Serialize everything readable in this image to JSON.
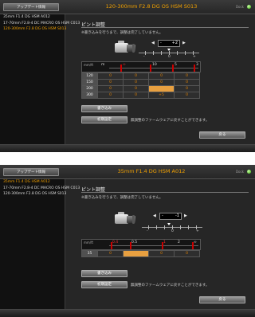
{
  "screens": [
    {
      "update_button": "アップデート情報",
      "title": "120-300mm F2.8 DG OS HSM S013",
      "dock_label": "Dock",
      "lenses": [
        "35mm F1.4 DG HSM A012",
        "17-70mm F2.8-4 DC MACRO OS HSM C013",
        "120-300mm F2.8 DG OS HSM S013"
      ],
      "active_lens": 2,
      "section_title": "ピント調整",
      "note": "※書き込みを行うまで、調整は完了していません。",
      "stepper_value": "+2",
      "scale": {
        "left": "-",
        "mid": "0",
        "right": "+"
      },
      "focus_header": {
        "corner": "mm/ft",
        "labels": [
          "m",
          "∞",
          "10",
          "5",
          "3"
        ]
      },
      "rows": [
        {
          "zoom": "120",
          "values": [
            "0",
            "0",
            "0",
            "0"
          ]
        },
        {
          "zoom": "150",
          "values": [
            "0",
            "0",
            "0",
            "0"
          ]
        },
        {
          "zoom": "200",
          "values": [
            "0",
            "0",
            "",
            "0"
          ]
        },
        {
          "zoom": "300",
          "values": [
            "0",
            "0",
            "+5",
            "0"
          ]
        }
      ],
      "highlight": [
        2,
        2
      ],
      "write_button": "書き込み",
      "init_button": "初期設定",
      "init_note": "無調整のファームウェアに戻すことができます。",
      "back_button": "戻る"
    },
    {
      "update_button": "アップデート情報",
      "title": "35mm F1.4 DG HSM A012",
      "dock_label": "Dock",
      "lenses": [
        "35mm F1.4 DG HSM A012",
        "17-70mm F2.8-4 DC MACRO OS HSM C013",
        "120-300mm F2.8 DG OS HSM S013"
      ],
      "active_lens": 0,
      "section_title": "ピント調整",
      "note": "※書き込みを行うまで、調整は完了していません。",
      "stepper_value": "-1",
      "scale": {
        "left": "-",
        "mid": "0",
        "right": "+"
      },
      "focus_header": {
        "corner": "mm/ft",
        "labels": [
          "0.4",
          "0.5",
          "1",
          "2",
          "∞"
        ]
      },
      "rows": [
        {
          "zoom": "35",
          "values": [
            "0",
            "",
            "0",
            "0"
          ]
        }
      ],
      "highlight": [
        0,
        1
      ],
      "write_button": "書き込み",
      "init_button": "初期設定",
      "init_note": "無調整のファームウェアに戻すことができます。",
      "back_button": "戻る"
    }
  ]
}
